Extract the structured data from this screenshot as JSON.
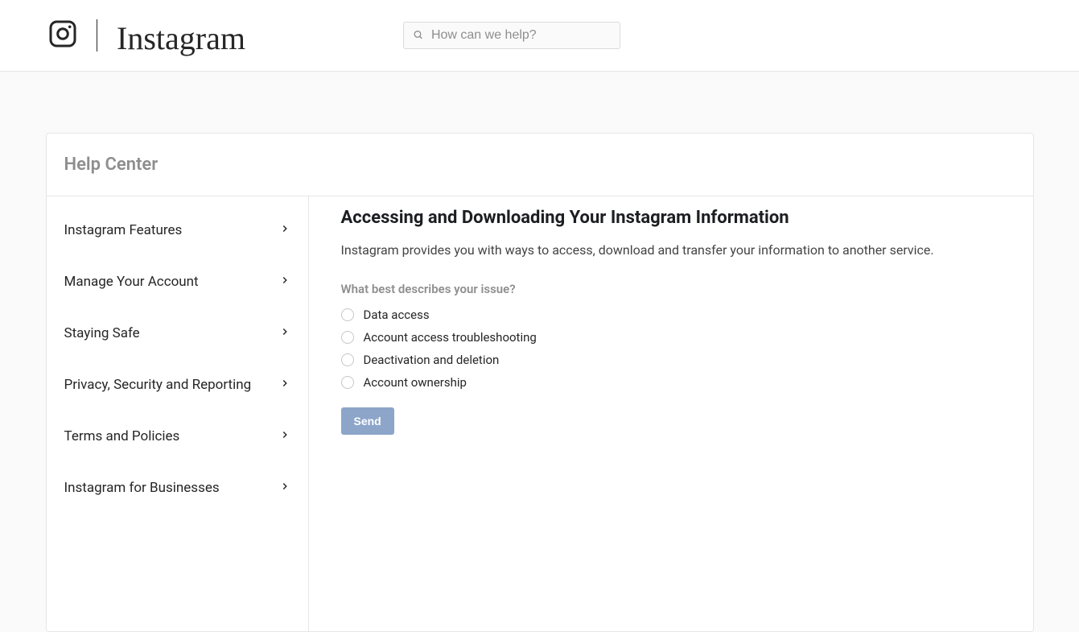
{
  "header": {
    "wordmark": "Instagram",
    "search_placeholder": "How can we help?"
  },
  "help_center": {
    "title": "Help Center"
  },
  "sidebar": {
    "items": [
      {
        "label": "Instagram Features"
      },
      {
        "label": "Manage Your Account"
      },
      {
        "label": "Staying Safe"
      },
      {
        "label": "Privacy, Security and Reporting"
      },
      {
        "label": "Terms and Policies"
      },
      {
        "label": "Instagram for Businesses"
      }
    ]
  },
  "article": {
    "title": "Accessing and Downloading Your Instagram Information",
    "lead": "Instagram provides you with ways to access, download and transfer your information to another service.",
    "question": "What best describes your issue?",
    "options": [
      {
        "label": "Data access"
      },
      {
        "label": "Account access troubleshooting"
      },
      {
        "label": "Deactivation and deletion"
      },
      {
        "label": "Account ownership"
      }
    ],
    "send_label": "Send"
  }
}
